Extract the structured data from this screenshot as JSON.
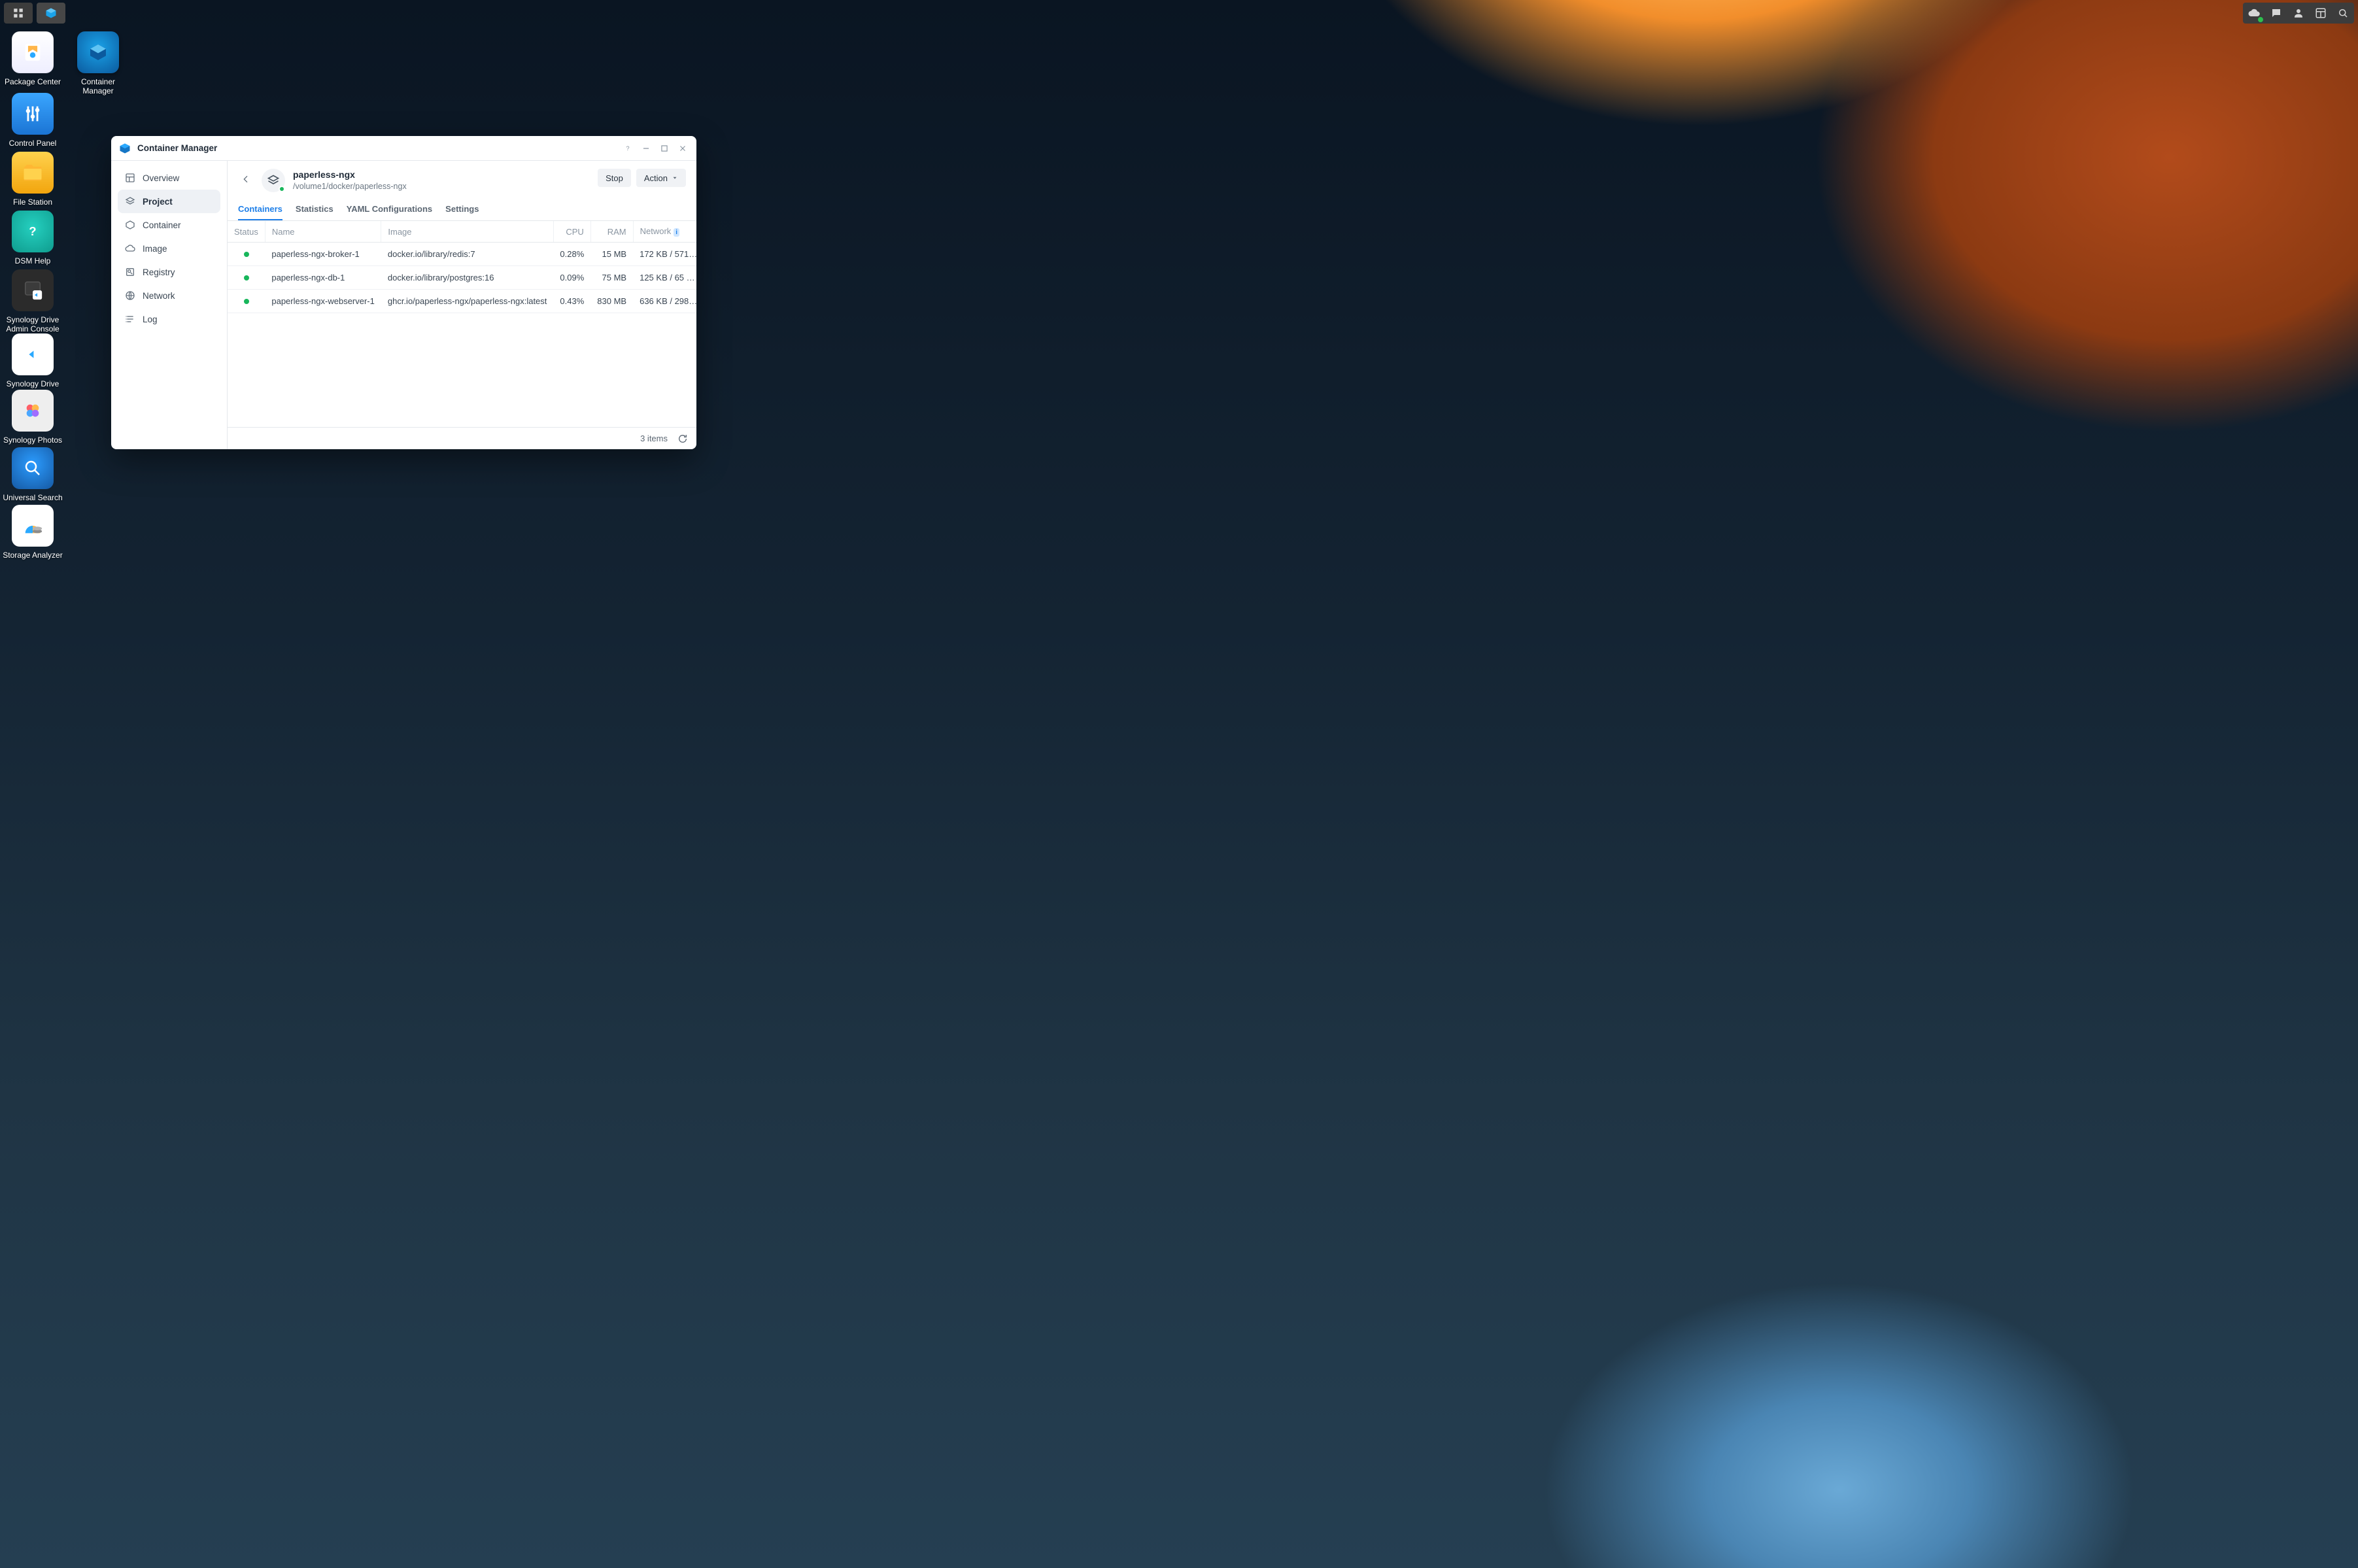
{
  "desktop_icons": {
    "col1": [
      {
        "label": "Package Center"
      },
      {
        "label": "Control Panel"
      },
      {
        "label": "File Station"
      },
      {
        "label": "DSM Help"
      },
      {
        "label": "Synology Drive Admin Console"
      },
      {
        "label": "Synology Drive"
      },
      {
        "label": "Synology Photos"
      },
      {
        "label": "Universal Search"
      },
      {
        "label": "Storage Analyzer"
      }
    ],
    "col2": [
      {
        "label": "Container Manager"
      }
    ]
  },
  "window": {
    "title": "Container Manager",
    "sidebar": [
      {
        "key": "overview",
        "label": "Overview"
      },
      {
        "key": "project",
        "label": "Project",
        "active": true
      },
      {
        "key": "container",
        "label": "Container"
      },
      {
        "key": "image",
        "label": "Image"
      },
      {
        "key": "registry",
        "label": "Registry"
      },
      {
        "key": "network",
        "label": "Network"
      },
      {
        "key": "log",
        "label": "Log"
      }
    ],
    "project": {
      "title": "paperless-ngx",
      "path": "/volume1/docker/paperless-ngx",
      "stop_label": "Stop",
      "action_label": "Action"
    },
    "tabs": [
      {
        "key": "containers",
        "label": "Containers",
        "active": true
      },
      {
        "key": "statistics",
        "label": "Statistics"
      },
      {
        "key": "yaml",
        "label": "YAML Configurations"
      },
      {
        "key": "settings",
        "label": "Settings"
      }
    ],
    "columns": {
      "status": "Status",
      "name": "Name",
      "image": "Image",
      "cpu": "CPU",
      "ram": "RAM",
      "network": "Network"
    },
    "rows": [
      {
        "status": "running",
        "name": "paperless-ngx-broker-1",
        "image": "docker.io/library/redis:7",
        "cpu": "0.28%",
        "ram": "15 MB",
        "net": "172 KB / 571…"
      },
      {
        "status": "running",
        "name": "paperless-ngx-db-1",
        "image": "docker.io/library/postgres:16",
        "cpu": "0.09%",
        "ram": "75 MB",
        "net": "125 KB / 65 …"
      },
      {
        "status": "running",
        "name": "paperless-ngx-webserver-1",
        "image": "ghcr.io/paperless-ngx/paperless-ngx:latest",
        "cpu": "0.43%",
        "ram": "830 MB",
        "net": "636 KB / 298…"
      }
    ],
    "footer": {
      "count": "3 items"
    }
  }
}
